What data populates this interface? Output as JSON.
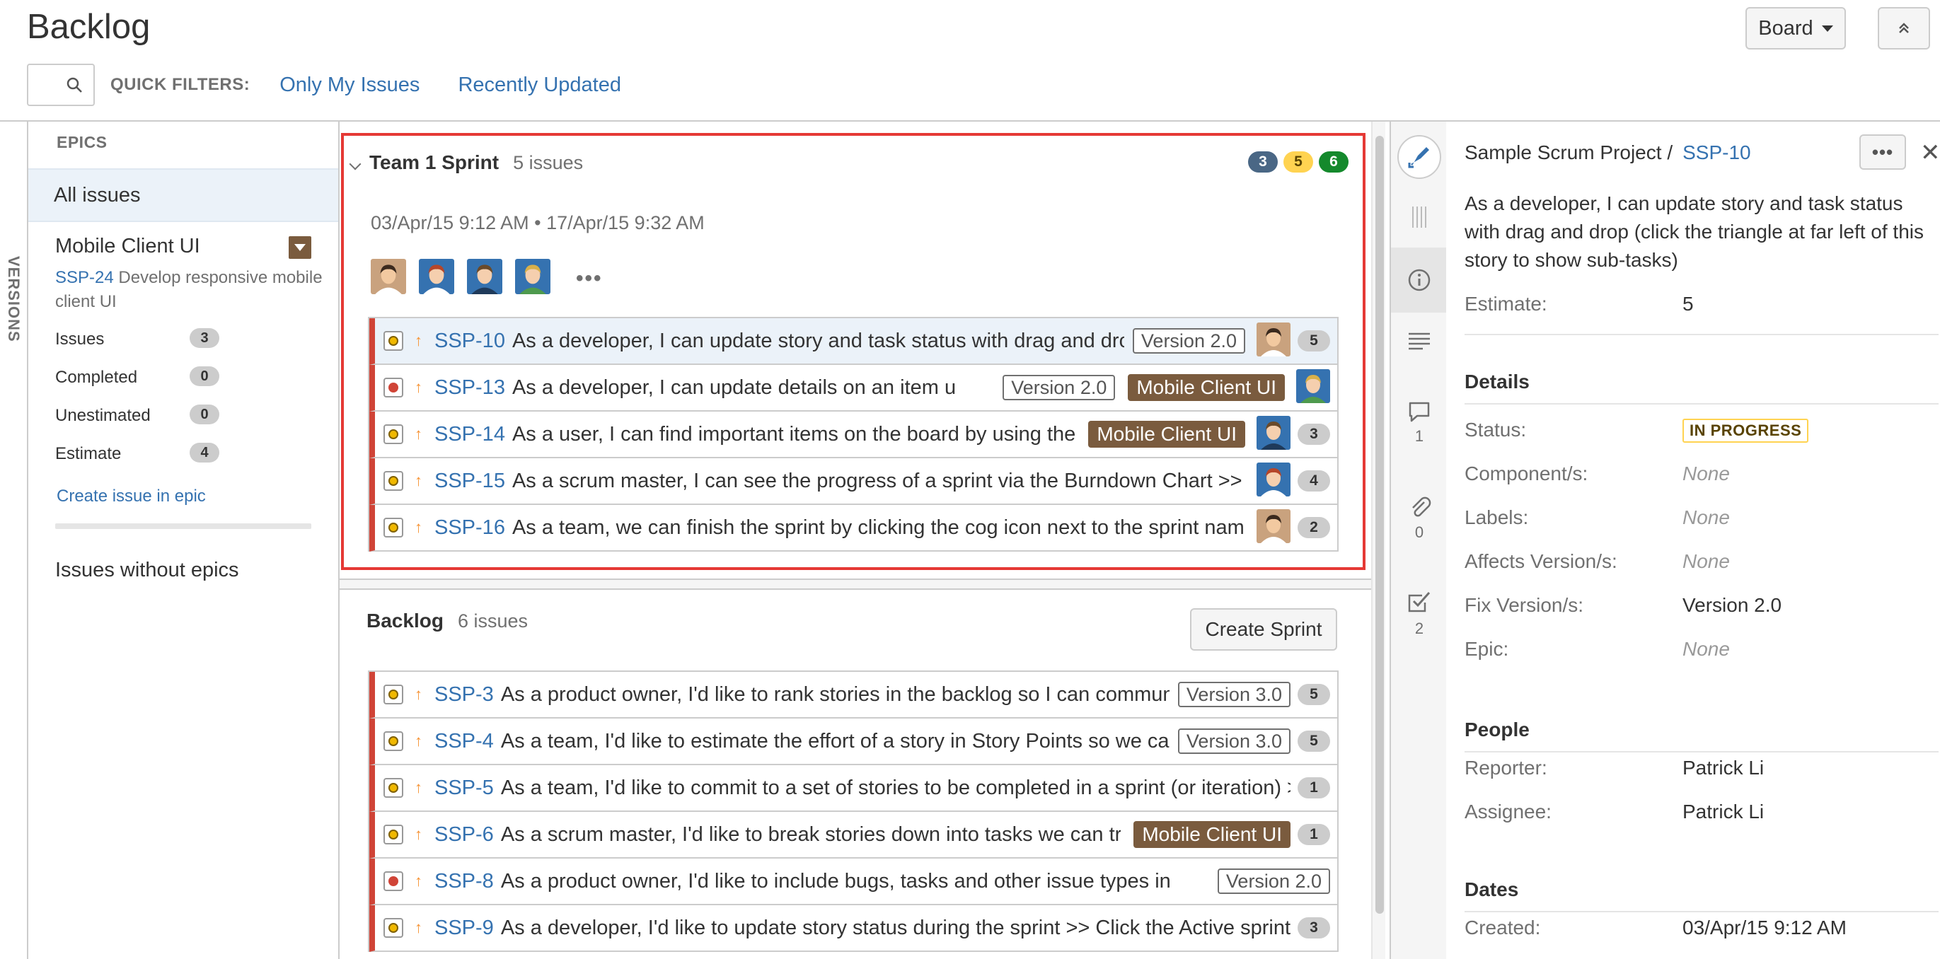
{
  "header": {
    "title": "Backlog",
    "board_label": "Board",
    "quick_filters_label": "QUICK FILTERS:",
    "filters": [
      "Only My Issues",
      "Recently Updated"
    ]
  },
  "versions": {
    "label": "VERSIONS"
  },
  "epics": {
    "heading": "EPICS",
    "all_issues": "All issues",
    "epic": {
      "name": "Mobile Client UI",
      "key": "SSP-24",
      "desc": "Develop responsive mobile client UI",
      "stats": [
        {
          "label": "Issues",
          "value": "3"
        },
        {
          "label": "Completed",
          "value": "0"
        },
        {
          "label": "Unestimated",
          "value": "0"
        },
        {
          "label": "Estimate",
          "value": "4"
        }
      ],
      "create_link": "Create issue in epic"
    },
    "without_epics": "Issues without epics"
  },
  "sprint": {
    "name": "Team 1 Sprint",
    "count": "5 issues",
    "dates": "03/Apr/15 9:12 AM  •  17/Apr/15 9:32 AM",
    "pills": {
      "todo": "3",
      "inprogress": "5",
      "done": "6"
    },
    "more": "•••",
    "issues": [
      {
        "type": "story",
        "key": "SSP-10",
        "summary": "As a developer, I can update story and task status with drag and dro",
        "version": "Version 2.0",
        "epic": "",
        "avatar": "man-dark",
        "estimate": "5",
        "selected": true
      },
      {
        "type": "bug",
        "key": "SSP-13",
        "summary": "As a developer, I can update details on an item u",
        "version": "Version 2.0",
        "epic": "Mobile Client UI",
        "avatar": "man-green",
        "estimate": "",
        "selected": false
      },
      {
        "type": "story",
        "key": "SSP-14",
        "summary": "As a user, I can find important items on the board by using the c",
        "version": "",
        "epic": "Mobile Client UI",
        "avatar": "man-suit",
        "estimate": "3",
        "selected": false
      },
      {
        "type": "story",
        "key": "SSP-15",
        "summary": "As a scrum master, I can see the progress of a sprint via the Burndown Chart >> Cl",
        "version": "",
        "epic": "",
        "avatar": "woman-red",
        "estimate": "4",
        "selected": false
      },
      {
        "type": "story",
        "key": "SSP-16",
        "summary": "As a team, we can finish the sprint by clicking the cog icon next to the sprint name a",
        "version": "",
        "epic": "",
        "avatar": "man-dark",
        "estimate": "2",
        "selected": false
      }
    ]
  },
  "backlog": {
    "name": "Backlog",
    "count": "6 issues",
    "create_sprint": "Create Sprint",
    "issues": [
      {
        "type": "story",
        "key": "SSP-3",
        "summary": "As a product owner, I'd like to rank stories in the backlog so I can commun",
        "version": "Version 3.0",
        "epic": "",
        "estimate": "5"
      },
      {
        "type": "story",
        "key": "SSP-4",
        "summary": "As a team, I'd like to estimate the effort of a story in Story Points so we car",
        "version": "Version 3.0",
        "epic": "",
        "estimate": "5"
      },
      {
        "type": "story",
        "key": "SSP-5",
        "summary": "As a team, I'd like to commit to a set of stories to be completed in a sprint (or iteration) >>",
        "version": "",
        "epic": "",
        "estimate": "1"
      },
      {
        "type": "story",
        "key": "SSP-6",
        "summary": "As a scrum master, I'd like to break stories down into tasks we can tra",
        "version": "",
        "epic": "Mobile Client UI",
        "estimate": "1"
      },
      {
        "type": "bug",
        "key": "SSP-8",
        "summary": "As a product owner, I'd like to include bugs, tasks and other issue types in",
        "version": "Version 2.0",
        "epic": "",
        "estimate": ""
      },
      {
        "type": "story",
        "key": "SSP-9",
        "summary": "As a developer, I'd like to update story status during the sprint >> Click the Active sprints",
        "version": "",
        "epic": "",
        "estimate": "3"
      }
    ]
  },
  "detail": {
    "project": "Sample Scrum Project /",
    "key": "SSP-10",
    "summary": "As a developer, I can update story and task status with drag and drop (click the triangle at far left of this story to show sub-tasks)",
    "estimate_label": "Estimate:",
    "estimate_value": "5",
    "details_head": "Details",
    "fields": [
      {
        "label": "Status:",
        "value": "IN PROGRESS",
        "kind": "status"
      },
      {
        "label": "Component/s:",
        "value": "None",
        "kind": "none"
      },
      {
        "label": "Labels:",
        "value": "None",
        "kind": "none"
      },
      {
        "label": "Affects Version/s:",
        "value": "None",
        "kind": "none"
      },
      {
        "label": "Fix Version/s:",
        "value": "Version 2.0",
        "kind": "text"
      },
      {
        "label": "Epic:",
        "value": "None",
        "kind": "none"
      }
    ],
    "people_head": "People",
    "reporter_label": "Reporter:",
    "reporter": "Patrick Li",
    "assignee_label": "Assignee:",
    "assignee": "Patrick Li",
    "dates_head": "Dates",
    "created_label": "Created:",
    "created": "03/Apr/15 9:12 AM",
    "rail": {
      "comments": "1",
      "attachments": "0",
      "subtasks": "2"
    }
  },
  "colors": {
    "link": "#3572b0",
    "epic": "#7a5b3e",
    "priority": "#f79232",
    "rank_bar": "#d04437",
    "highlight": "#e53935"
  }
}
